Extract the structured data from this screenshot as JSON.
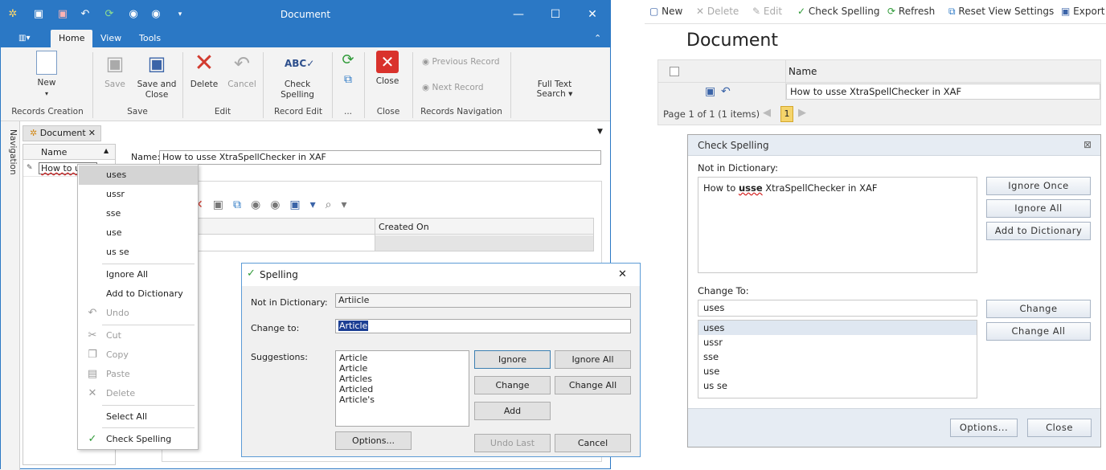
{
  "left_window": {
    "title": "Document",
    "qat_icons": [
      "app-icon",
      "save-icon",
      "save-close-icon",
      "undo-icon",
      "refresh-icon",
      "prev-icon",
      "next-icon",
      "customize-icon"
    ],
    "tabs": [
      "Home",
      "View",
      "Tools"
    ],
    "ribbon": {
      "new": "New",
      "save": "Save",
      "save_and_close": "Save and Close",
      "delete": "Delete",
      "cancel": "Cancel",
      "check_spelling": "Check Spelling",
      "close": "Close",
      "previous_record": "Previous Record",
      "next_record": "Next Record",
      "full_text_search": "Full Text Search",
      "groups": [
        "Records Creation",
        "Save",
        "Edit",
        "Record Edit",
        "...",
        "Close",
        "Records Navigation"
      ]
    },
    "navigation_label": "Navigation",
    "doc_tab": "Document",
    "list": {
      "column": "Name",
      "row": "How to usse"
    },
    "detail": {
      "name_label": "Name:",
      "name_value": "How to usse XtraSpellChecker in XAF",
      "grid_column": "Created On"
    }
  },
  "context_menu": {
    "suggestions": [
      "uses",
      "ussr",
      "sse",
      "use",
      "us se"
    ],
    "ignore_all": "Ignore All",
    "add_to_dictionary": "Add to Dictionary",
    "undo": "Undo",
    "cut": "Cut",
    "copy": "Copy",
    "paste": "Paste",
    "delete": "Delete",
    "select_all": "Select All",
    "check_spelling": "Check Spelling"
  },
  "spelling_dialog": {
    "title": "Spelling",
    "not_in_dictionary_label": "Not in Dictionary:",
    "not_in_dictionary_value": "Artiicle",
    "change_to_label": "Change to:",
    "change_to_value": "Article",
    "suggestions_label": "Suggestions:",
    "suggestions": [
      "Article",
      "Article",
      "Articles",
      "Articled",
      "Article's"
    ],
    "buttons": {
      "ignore": "Ignore",
      "ignore_all": "Ignore All",
      "change": "Change",
      "change_all": "Change All",
      "add": "Add",
      "options": "Options...",
      "undo_last": "Undo Last",
      "cancel": "Cancel"
    }
  },
  "right_app": {
    "toolbar": {
      "new": "New",
      "delete": "Delete",
      "edit": "Edit",
      "check_spelling": "Check Spelling",
      "refresh": "Refresh",
      "reset_view_settings": "Reset View Settings",
      "export": "Export"
    },
    "page_title": "Document",
    "grid": {
      "column": "Name",
      "row": "How to usse XtraSpellChecker in XAF"
    },
    "pager": {
      "text": "Page 1 of 1 (1 items)",
      "current_page": "1"
    },
    "check_spelling_dialog": {
      "title": "Check Spelling",
      "not_in_dictionary_label": "Not in Dictionary:",
      "sentence_before": "How to ",
      "misspelled": "usse",
      "sentence_after": " XtraSpellChecker in XAF",
      "buttons": {
        "ignore_once": "Ignore Once",
        "ignore_all": "Ignore All",
        "add_to_dictionary": "Add to Dictionary",
        "change": "Change",
        "change_all": "Change All",
        "options": "Options...",
        "close": "Close"
      },
      "change_to_label": "Change To:",
      "change_to_value": "uses",
      "suggestions": [
        "uses",
        "ussr",
        "sse",
        "use",
        "us se"
      ]
    }
  },
  "colors": {
    "accent": "#2b78c5",
    "ribbon_bg": "#f3f3f3",
    "dialog_header": "#e6ecf3",
    "selection": "#d4d4d4"
  }
}
